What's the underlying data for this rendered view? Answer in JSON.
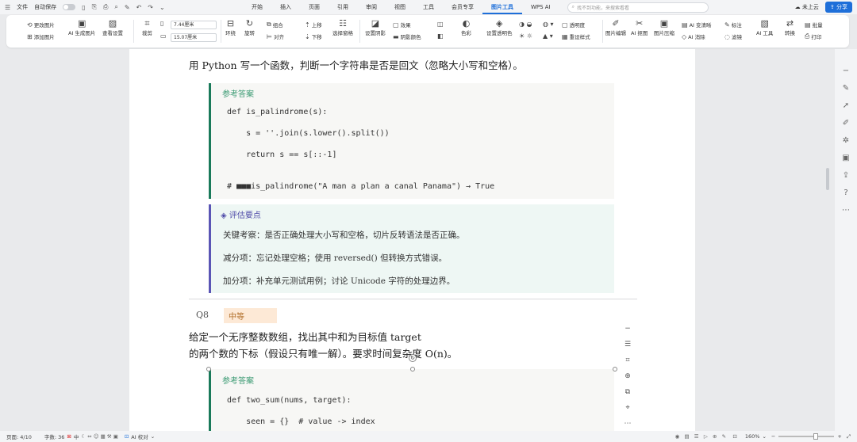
{
  "titlebar": {
    "file": "文件",
    "autosave": "自动保存",
    "tabs": [
      "开始",
      "插入",
      "页面",
      "引用",
      "审阅",
      "视图",
      "工具",
      "会员专享",
      "图片工具",
      "WPS AI"
    ],
    "active_tab": "图片工具",
    "search_placeholder": "找不到功能，来搜索看看",
    "cloud": "未上云",
    "share": "分享"
  },
  "ribbon": {
    "change_image": "更改图片",
    "add_image": "添加图片",
    "ai_gen_image": "AI 生成图片",
    "view_settings": "查看设置",
    "crop": "裁剪",
    "width": "7.44厘米",
    "height": "15.07厘米",
    "wrap": "环绕",
    "rotate": "旋转",
    "combine": "组合",
    "align": "对齐",
    "up": "上移",
    "down": "下移",
    "select_pane": "选择窗格",
    "shadow": "设置阴影",
    "shadow_color": "阴影颜色",
    "effects": "效果",
    "color": "色彩",
    "set_transparent": "设置透明色",
    "transparency": "透明度",
    "reset_style": "重设样式",
    "image_edit": "图片编辑",
    "ai_cutout": "AI 抠图",
    "image_compress": "图片压缩",
    "ai_enhance": "AI 变清晰",
    "ai_remove": "AI 消除",
    "annotate": "标注",
    "filter": "滤镜",
    "ai_tools": "AI 工具",
    "convert": "转换",
    "batch": "批量",
    "print": "打印"
  },
  "document": {
    "question_line": "用 Python 写一个函数，判断一个字符串是否是回文（忽略大小写和空格）。",
    "answer_label": "参考答案",
    "code1": [
      "def is_palindrome(s):",
      "    s = ''.join(s.lower().split())",
      "    return s == s[::-1]",
      "# ■■■is_palindrome(\"A man a plan a canal Panama\") → True"
    ],
    "eval_title": "◈ 评估要点",
    "eval_lines": [
      "关键考察：是否正确处理大小写和空格，切片反转语法是否正确。",
      "减分项：忘记处理空格；使用 reversed() 但转换方式错误。",
      "加分项：补充单元测试用例；讨论 Unicode 字符的处理边界。"
    ],
    "q8_label": "Q8",
    "q8_badge": "中等",
    "q8_line1": "给定一个无序整数数组，找出其中和为目标值 target",
    "q8_line2": "的两个数的下标（假设只有唯一解）。要求时间复杂度 O(n)。",
    "answer_label2": "参考答案",
    "code2": [
      "def two_sum(nums, target):",
      "    seen = {}  # value -> index"
    ]
  },
  "statusbar": {
    "page": "页面: 4/10",
    "words": "字数: 36",
    "lang": "中",
    "ai_check": "AI 校对",
    "zoom": "160%"
  },
  "colors": {
    "accent": "#1e6fd9",
    "code_border": "#1a7a5a",
    "eval_border": "#5a55b5",
    "badge_bg": "#fde9d6"
  }
}
